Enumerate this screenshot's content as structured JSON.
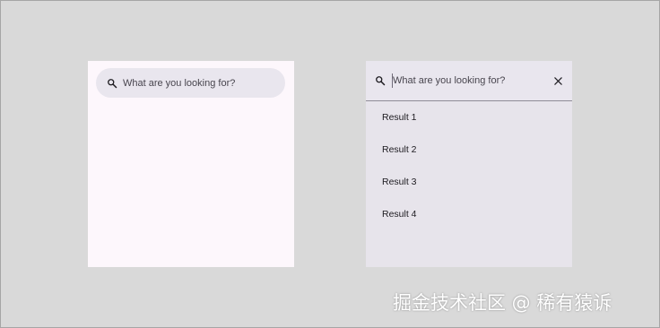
{
  "collapsed_search": {
    "placeholder": "What are you looking for?",
    "icon": "search-icon"
  },
  "expanded_search": {
    "placeholder": "What are you looking for?",
    "icon": "search-icon",
    "clear_icon": "close-icon",
    "results": [
      {
        "label": "Result 1"
      },
      {
        "label": "Result 2"
      },
      {
        "label": "Result 3"
      },
      {
        "label": "Result 4"
      }
    ]
  },
  "watermark": {
    "text": "掘金技术社区 @ 稀有猿诉"
  },
  "colors": {
    "background": "#d9d9d9",
    "surface_light": "#fdf7fc",
    "search_bar": "#e9e6ee",
    "surface_expanded": "#e7e4eb",
    "text_primary": "#1d1b20",
    "text_secondary": "#48454e"
  }
}
